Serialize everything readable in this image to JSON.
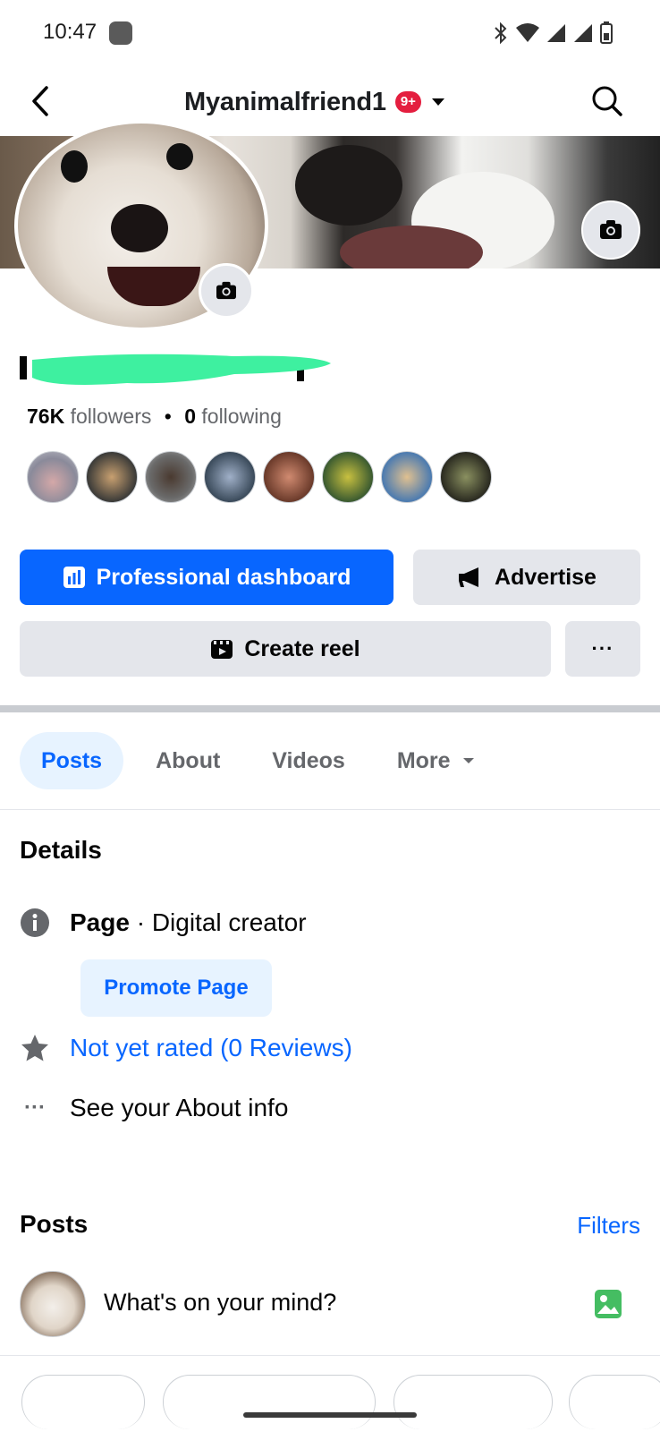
{
  "status_bar": {
    "time": "10:47"
  },
  "header": {
    "title": "Myanimalfriend1",
    "badge": "9+",
    "icons": [
      "back-arrow-icon",
      "caret-down-icon",
      "search-icon"
    ]
  },
  "profile": {
    "followers_count": "76K",
    "followers_label": "followers",
    "separator": "•",
    "following_count": "0",
    "following_label": "following"
  },
  "actions": {
    "dashboard_label": "Professional dashboard",
    "advertise_label": "Advertise",
    "create_reel_label": "Create reel",
    "more_label": "···"
  },
  "tabs": {
    "posts": "Posts",
    "about": "About",
    "videos": "Videos",
    "more": "More"
  },
  "details": {
    "title": "Details",
    "page_type_bold": "Page",
    "page_type_rest": " · Digital creator",
    "promote_label": "Promote Page",
    "rating_text": "Not yet rated (0 Reviews)",
    "about_info_text": "See your About info",
    "about_dots": "···"
  },
  "posts_section": {
    "title": "Posts",
    "filters_label": "Filters",
    "composer_placeholder": "What's on your mind?"
  },
  "colors": {
    "brand_blue": "#0866ff",
    "badge_red": "#e41e3f",
    "secondary_bg": "#e4e6eb",
    "redaction_green": "#3ef0a0"
  }
}
